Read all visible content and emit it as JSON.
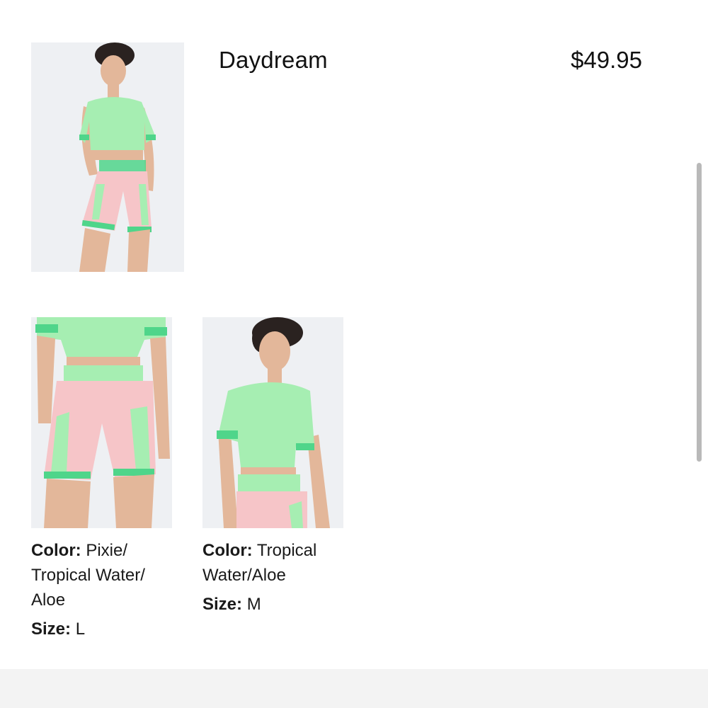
{
  "product": {
    "name": "Daydream",
    "price": "$49.95"
  },
  "images": {
    "main": "product-photo-front",
    "variant_a": "product-photo-shorts-closeup",
    "variant_b": "product-photo-top-closeup"
  },
  "variants": [
    {
      "color_label": "Color:",
      "color_value": "Pixie/ Tropical Water/ Aloe",
      "size_label": "Size:",
      "size_value": "L"
    },
    {
      "color_label": "Color:",
      "color_value": "Tropical Water/Aloe",
      "size_label": "Size:",
      "size_value": "M"
    }
  ],
  "colors": {
    "top_green": "#a6eeb2",
    "trim_green": "#4fd58a",
    "shorts_pink": "#f6c5c8",
    "skin": "#e3b79a",
    "hair": "#2a2220",
    "photo_bg": "#eef0f3"
  }
}
